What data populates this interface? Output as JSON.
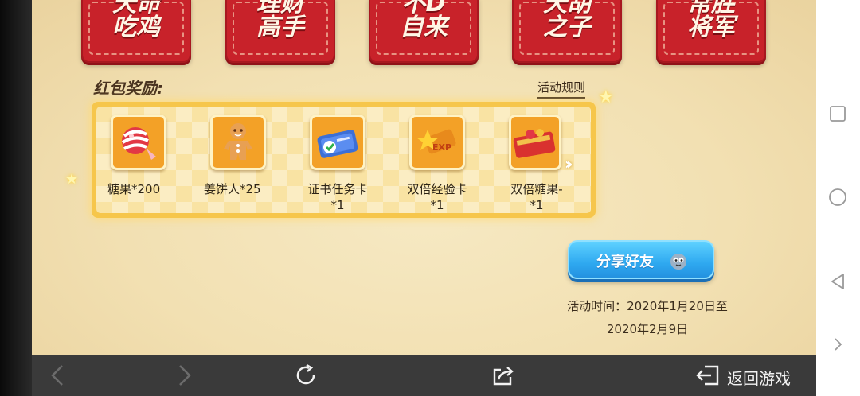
{
  "title_cards": [
    {
      "line1": "天命",
      "line2": "吃鸡"
    },
    {
      "line1": "理财",
      "line2": "高手"
    },
    {
      "line1": "不D",
      "line2": "自来"
    },
    {
      "line1": "天胡",
      "line2": "之子"
    },
    {
      "line1": "常胜",
      "line2": "将军"
    }
  ],
  "reward_section": {
    "title": "红包奖励:",
    "rules_link": "活动规则",
    "items": [
      {
        "line1": "糖果*200",
        "line2": "",
        "icon": "candy-icon"
      },
      {
        "line1": "姜饼人*25",
        "line2": "",
        "icon": "gingerbread-icon"
      },
      {
        "line1": "证书任务卡",
        "line2": "*1",
        "icon": "certificate-card-icon"
      },
      {
        "line1": "双倍经验卡",
        "line2": "*1",
        "icon": "exp-card-icon"
      },
      {
        "line1": "双倍糖果-",
        "line2": "*1",
        "icon": "candy-card-icon"
      }
    ],
    "more_icon": "double-chevron-right-icon"
  },
  "share_button": {
    "label": "分享好友",
    "icon": "mascot-icon"
  },
  "activity_time": {
    "line1": "活动时间：2020年1月20日至",
    "line2": "2020年2月9日"
  },
  "browser_bar": {
    "return_label": "返回游戏"
  },
  "colors": {
    "card_red": "#c8222a",
    "parchment": "#f2e0b2",
    "panel_gold": "#f6c64b",
    "share_blue": "#2fa9f0",
    "bar_dark": "#3a3a3a"
  }
}
